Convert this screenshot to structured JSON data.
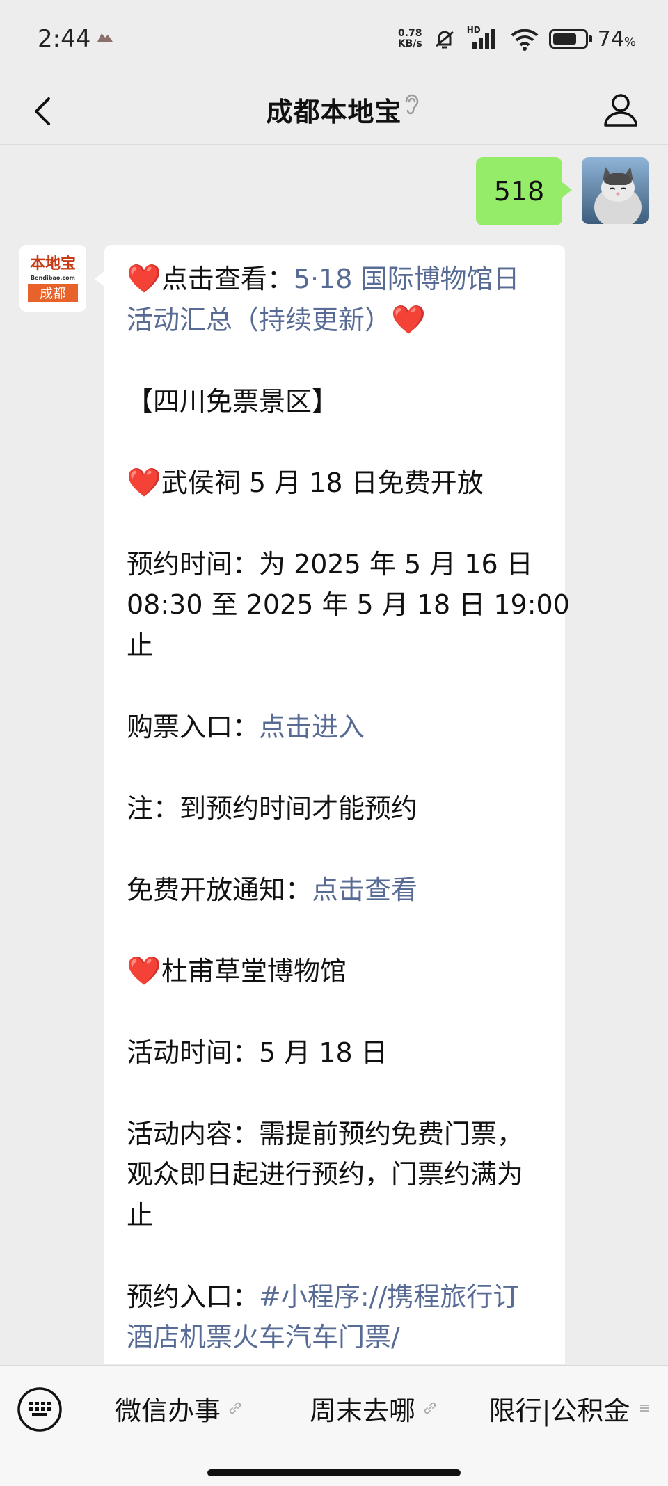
{
  "status_bar": {
    "time": "2:44",
    "net_speed_value": "0.78",
    "net_speed_unit": "KB/s",
    "signal_label": "HD",
    "battery_percent": "74",
    "battery_percent_sign": "%",
    "battery_level": 0.74
  },
  "header": {
    "title": "成都本地宝"
  },
  "chat": {
    "my_message": "518",
    "bot_avatar": {
      "logo_top": "本地宝",
      "logo_url": "Bendibao.com",
      "logo_city": "成都"
    },
    "bot_message": {
      "heart": "❤️",
      "line1_prefix": "点击查看：",
      "line1_link": "5·18 国际博物馆日",
      "line2_link": "活动汇总（持续更新）",
      "section_title": "【四川免票景区】",
      "item1_title": "武侯祠 5 月 18 日免费开放",
      "booking_time_line1": "预约时间：为 2025 年 5 月 16 日",
      "booking_time_line2": "08:30 至 2025 年 5 月 18 日 19:00",
      "booking_time_line3": "止",
      "ticket_label": "购票入口：",
      "ticket_link": "点击进入",
      "note": "注：到预约时间才能预约",
      "notice_label": "免费开放通知：",
      "notice_link": "点击查看",
      "item2_title": "杜甫草堂博物馆",
      "activity_time": "活动时间：5 月 18 日",
      "activity_content_line1": "活动内容：需提前预约免费门票，",
      "activity_content_line2": "观众即日起进行预约，门票约满为",
      "activity_content_line3": "止",
      "reserve_label": "预约入口：",
      "reserve_link_line1": "#小程序://携程旅行订",
      "reserve_link_line2": "酒店机票火车汽车门票/"
    }
  },
  "bottom_menu": {
    "items": [
      "微信办事",
      "周末去哪",
      "限行|公积金"
    ]
  }
}
